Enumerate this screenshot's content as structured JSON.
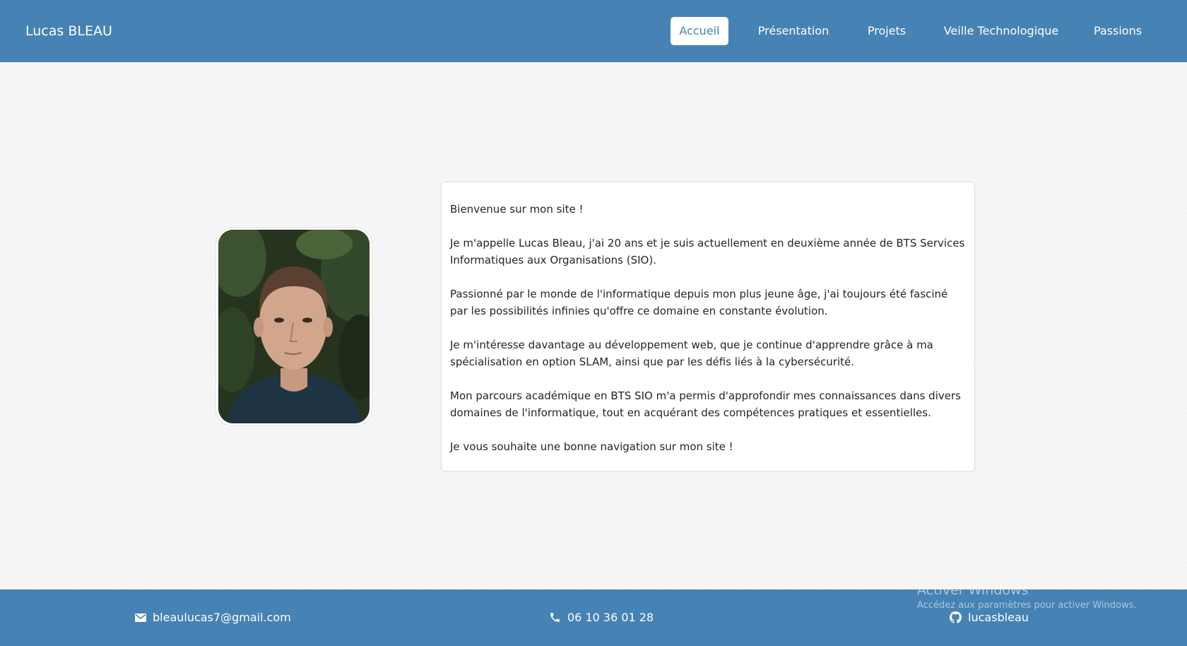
{
  "header": {
    "brand": "Lucas BLEAU",
    "nav": [
      {
        "label": "Accueil",
        "active": true
      },
      {
        "label": "Présentation",
        "active": false
      },
      {
        "label": "Projets",
        "active": false
      },
      {
        "label": "Veille Technologique",
        "active": false
      },
      {
        "label": "Passions",
        "active": false
      }
    ]
  },
  "main": {
    "paragraphs": [
      "Bienvenue sur mon site !",
      "Je m'appelle Lucas Bleau, j'ai 20 ans et je suis actuellement en deuxième année de BTS Services Informatiques aux Organisations (SIO).",
      "Passionné par le monde de l'informatique depuis mon plus jeune âge, j'ai toujours été fasciné par les possibilités infinies qu'offre ce domaine en constante évolution.",
      "Je m'intéresse davantage au développement web, que je continue d'apprendre grâce à ma spécialisation en option SLAM, ainsi que par les défis liés à la cybersécurité.",
      "Mon parcours académique en BTS SIO m'a permis d'approfondir mes connaissances dans divers domaines de l'informatique, tout en acquérant des compétences pratiques et essentielles.",
      "Je vous souhaite une bonne navigation sur mon site !"
    ]
  },
  "footer": {
    "email": {
      "icon": "envelope-icon",
      "text": "bleaulucas7@gmail.com"
    },
    "phone": {
      "icon": "phone-icon",
      "text": "06 10 36 01 28"
    },
    "github": {
      "icon": "github-icon",
      "text": "lucasbleau"
    }
  },
  "watermark": {
    "title": "Activer Windows",
    "subtitle": "Accédez aux paramètres pour activer Windows."
  },
  "colors": {
    "primary": "#4682b4",
    "background": "#f6f6f6",
    "card": "#ffffff",
    "text": "#212529"
  }
}
